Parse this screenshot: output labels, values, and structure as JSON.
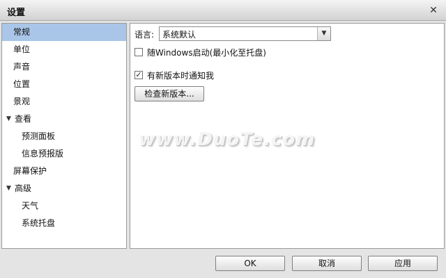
{
  "window": {
    "title": "设置",
    "close_glyph": "✕"
  },
  "sidebar": {
    "items": [
      {
        "label": "常规",
        "selected": true
      },
      {
        "label": "单位"
      },
      {
        "label": "声音"
      },
      {
        "label": "位置"
      },
      {
        "label": "景观"
      },
      {
        "label": "查看",
        "expanded": true
      },
      {
        "label": "预测面板"
      },
      {
        "label": "信息预报版"
      },
      {
        "label": "屏幕保护"
      },
      {
        "label": "高级",
        "expanded": true
      },
      {
        "label": "天气"
      },
      {
        "label": "系统托盘"
      }
    ]
  },
  "general": {
    "language_label": "语言:",
    "language_value": "系统默认",
    "startup_checkbox": {
      "label": "随Windows启动(最小化至托盘)",
      "checked": false
    },
    "notify_checkbox": {
      "label": "有新版本时通知我",
      "checked": true
    },
    "check_updates_button": "检查新版本..."
  },
  "footer": {
    "ok": "OK",
    "cancel": "取消",
    "apply": "应用"
  },
  "watermark": "www.DuoTe.com",
  "icons": {
    "expand": "triangle-down",
    "dropdown": "triangle-down",
    "close": "x",
    "check": "checkmark"
  }
}
